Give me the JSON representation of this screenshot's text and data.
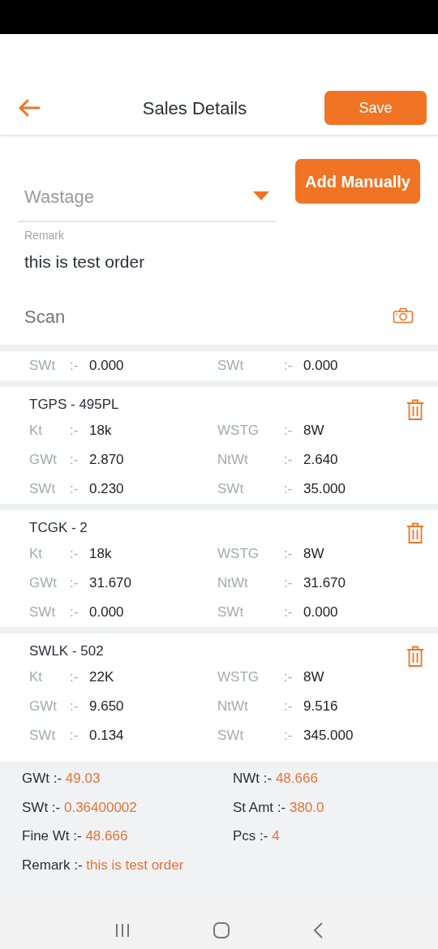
{
  "header": {
    "title": "Sales Details",
    "save": "Save"
  },
  "form": {
    "wastage": {
      "placeholder": "Wastage"
    },
    "add_manually": "Add Manually",
    "remark": {
      "label": "Remark",
      "value": "this is test order"
    },
    "scan": {
      "placeholder": "Scan"
    }
  },
  "items": [
    {
      "rows": [
        [
          {
            "label": "SWt",
            "sep": ":-",
            "value": "0.000"
          },
          {
            "label": "SWt",
            "sep": ":-",
            "value": "0.000"
          }
        ]
      ]
    },
    {
      "title": "TGPS - 495PL",
      "rows": [
        [
          {
            "label": "Kt",
            "sep": ":-",
            "value": "18k"
          },
          {
            "label": "WSTG",
            "sep": ":-",
            "value": "8W"
          }
        ],
        [
          {
            "label": "GWt",
            "sep": ":-",
            "value": "2.870"
          },
          {
            "label": "NtWt",
            "sep": ":-",
            "value": "2.640"
          }
        ],
        [
          {
            "label": "SWt",
            "sep": ":-",
            "value": "0.230"
          },
          {
            "label": "SWt",
            "sep": ":-",
            "value": "35.000"
          }
        ]
      ]
    },
    {
      "title": "TCGK - 2",
      "rows": [
        [
          {
            "label": "Kt",
            "sep": ":-",
            "value": "18k"
          },
          {
            "label": "WSTG",
            "sep": ":-",
            "value": "8W"
          }
        ],
        [
          {
            "label": "GWt",
            "sep": ":-",
            "value": "31.670"
          },
          {
            "label": "NtWt",
            "sep": ":-",
            "value": "31.670"
          }
        ],
        [
          {
            "label": "SWt",
            "sep": ":-",
            "value": "0.000"
          },
          {
            "label": "SWt",
            "sep": ":-",
            "value": "0.000"
          }
        ]
      ]
    },
    {
      "title": "SWLK - 502",
      "rows": [
        [
          {
            "label": "Kt",
            "sep": ":-",
            "value": "22K"
          },
          {
            "label": "WSTG",
            "sep": ":-",
            "value": "8W"
          }
        ],
        [
          {
            "label": "GWt",
            "sep": ":-",
            "value": "9.650"
          },
          {
            "label": "NtWt",
            "sep": ":-",
            "value": "9.516"
          }
        ],
        [
          {
            "label": "SWt",
            "sep": ":-",
            "value": "0.134"
          },
          {
            "label": "SWt",
            "sep": ":-",
            "value": "345.000"
          }
        ]
      ]
    }
  ],
  "summary": {
    "fields": [
      {
        "label": "GWt :-",
        "value": "49.03"
      },
      {
        "label": "NWt :-",
        "value": "48.666"
      },
      {
        "label": "SWt :-",
        "value": "0.36400002"
      },
      {
        "label": "St Amt :-",
        "value": "380.0"
      },
      {
        "label": "Fine Wt :-",
        "value": "48.666"
      },
      {
        "label": "Pcs :-",
        "value": "4"
      }
    ],
    "remark": {
      "label": "Remark :-",
      "value": "this is test order"
    }
  }
}
